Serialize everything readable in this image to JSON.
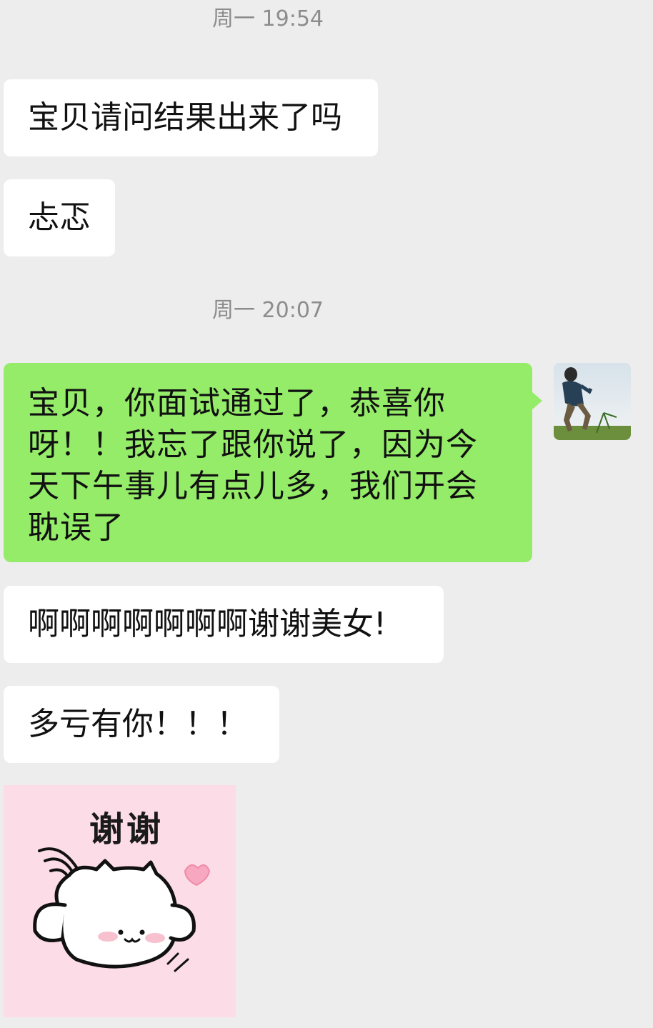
{
  "chat": {
    "timestamp_1": "周一 19:54",
    "timestamp_2": "周一 20:07",
    "messages": [
      {
        "sender": "other",
        "text": "宝贝请问结果出来了吗"
      },
      {
        "sender": "other",
        "text": "忐忑"
      },
      {
        "sender": "me",
        "text": "宝贝，你面试通过了，恭喜你呀！！我忘了跟你说了，因为今天下午事儿有点儿多，我们开会耽误了"
      },
      {
        "sender": "other",
        "text": "啊啊啊啊啊啊啊谢谢美女!"
      },
      {
        "sender": "other",
        "text": "多亏有你！！！"
      }
    ],
    "sticker": {
      "text": "谢谢",
      "icon": "cat-thank-you-sticker"
    },
    "avatar": {
      "icon": "person-running-in-field-avatar"
    }
  },
  "colors": {
    "background": "#ededed",
    "incoming_bubble": "#ffffff",
    "outgoing_bubble": "#95ec69",
    "timestamp_text": "#8c8c8c",
    "sticker_bg": "#fcdce6"
  }
}
